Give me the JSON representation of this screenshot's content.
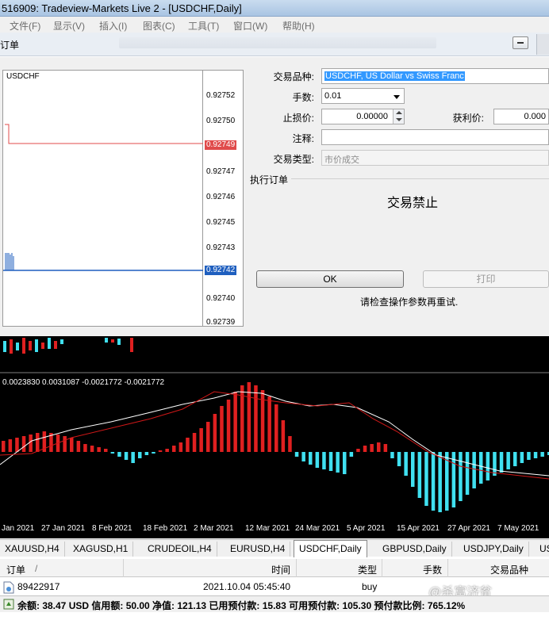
{
  "window": {
    "title": "516909: Tradeview-Markets Live 2 - [USDCHF,Daily]"
  },
  "menu": [
    "文件(F)",
    "显示(V)",
    "插入(I)",
    "图表(C)",
    "工具(T)",
    "窗口(W)",
    "帮助(H)"
  ],
  "dialog": {
    "title": "订单",
    "mini_chart": {
      "symbol": "USDCHF",
      "price_ticks": [
        "0.92752",
        "0.92750",
        "0.92749",
        "0.92747",
        "0.92746",
        "0.92745",
        "0.92743",
        "0.92742",
        "0.92740",
        "0.92739"
      ],
      "bid_tag": "0.92749",
      "ask_tag": "0.92742",
      "bid_color": "#e04b4b",
      "ask_color": "#1f5fbf"
    },
    "symbol_label": "交易品种:",
    "symbol_value": "USDCHF, US Dollar vs Swiss Franc",
    "volume_label": "手数:",
    "volume_value": "0.01",
    "sl_label": "止损价:",
    "sl_value": "0.00000",
    "tp_label": "获利价:",
    "tp_value": "0.000",
    "comment_label": "注释:",
    "comment_value": "",
    "type_label": "交易类型:",
    "type_value": "市价成交",
    "exec_group": "执行订单",
    "trade_disabled": "交易禁止",
    "ok_button": "OK",
    "print_button": "打印",
    "hint": "请检查操作参数再重试."
  },
  "main_chart": {
    "indicator_values": "0.0023830 0.0031087 -0.0021772 -0.0021772",
    "dates": [
      "Jan 2021",
      "27 Jan 2021",
      "8 Feb 2021",
      "18 Feb 2021",
      "2 Mar 2021",
      "12 Mar 2021",
      "24 Mar 2021",
      "5 Apr 2021",
      "15 Apr 2021",
      "27 Apr 2021",
      "7 May 2021"
    ],
    "colors": {
      "background": "#000000",
      "hist_up": "#e02020",
      "hist_down": "#40e0f0",
      "signal": "#d01818",
      "macd": "#ffffff"
    }
  },
  "tabs": [
    "XAUUSD,H4",
    "XAGUSD,H1",
    "CRUDEOIL,H4",
    "EURUSD,H4",
    "USDCHF,Daily",
    "GBPUSD,Daily",
    "USDJPY,Daily",
    "US"
  ],
  "active_tab": "USDCHF,Daily",
  "terminal": {
    "headers": {
      "order": "订单",
      "sort": "/",
      "time": "时间",
      "type": "类型",
      "volume": "手数",
      "symbol": "交易品种"
    },
    "rows": [
      {
        "order": "89422917",
        "time": "2021.10.04 05:45:40",
        "type": "buy",
        "volume": ""
      }
    ],
    "status": "余额: 38.47 USD  信用额: 50.00  净值: 121.13  已用预付款: 15.83  可用预付款: 105.30  预付款比例: 765.12%"
  },
  "watermark": "@杀富济贫"
}
